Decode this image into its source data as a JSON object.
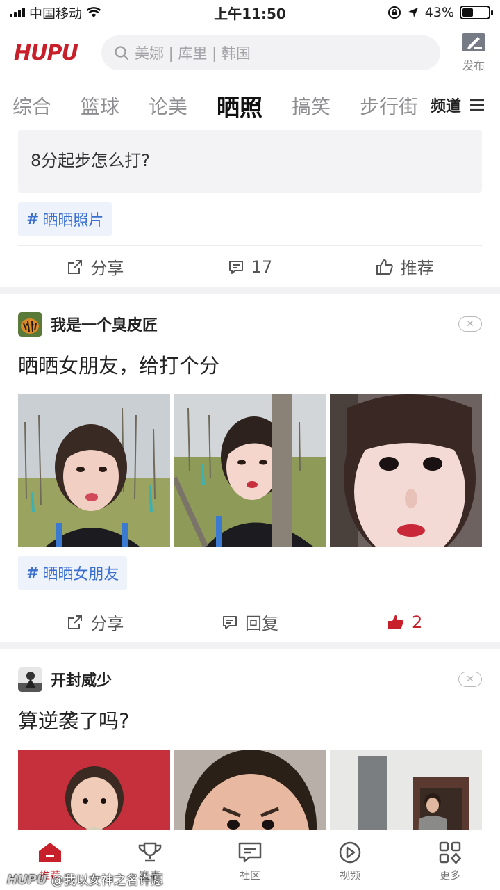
{
  "status_bar": {
    "carrier": "中国移动",
    "time": "上午11:50",
    "battery_percent_text": "43%",
    "battery_level": 0.43
  },
  "header": {
    "logo": "HUPU",
    "search_placeholder": "美娜 | 库里 | 韩国",
    "publish_label": "发布"
  },
  "tabs": {
    "items": [
      "综合",
      "篮球",
      "论美",
      "晒照",
      "搞笑",
      "步行街"
    ],
    "active": "晒照",
    "channels_label": "频道"
  },
  "prev_post": {
    "quote": "8分起步怎么打?",
    "tag": "晒晒照片",
    "share_label": "分享",
    "reply_label": "17",
    "recommend_label": "推荐"
  },
  "post1": {
    "username": "我是一个臭皮匠",
    "title": "晒晒女朋友，给打个分",
    "tag": "晒晒女朋友",
    "share_label": "分享",
    "reply_label": "回复",
    "likes": "2"
  },
  "post2": {
    "username": "开封威少",
    "title": "算逆袭了吗?"
  },
  "bottom_nav": {
    "items": [
      "推荐",
      "赛事",
      "社区",
      "视频",
      "更多"
    ],
    "active": "推荐"
  },
  "watermark": {
    "logo": "HUPU",
    "text": "@我以女神之名许愿"
  },
  "colors": {
    "brand": "#c8202a",
    "tag_blue": "#3a6fd0"
  }
}
